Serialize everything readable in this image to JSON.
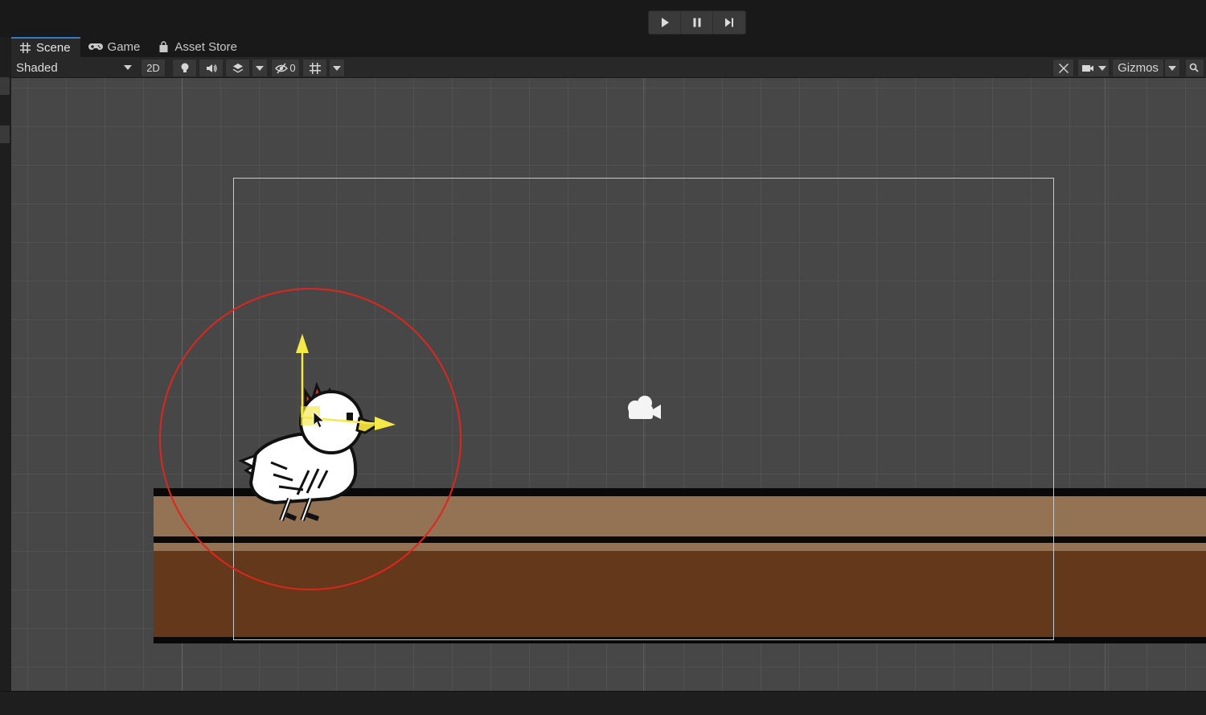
{
  "toolbar": {
    "play": "play-icon",
    "pause": "pause-icon",
    "step": "step-icon"
  },
  "tabs": [
    {
      "label": "Scene",
      "icon": "grid-hash-icon"
    },
    {
      "label": "Game",
      "icon": "gamepad-icon"
    },
    {
      "label": "Asset Store",
      "icon": "shopping-bag-icon"
    }
  ],
  "scene_toolbar": {
    "shading_mode": "Shaded",
    "mode_2d": "2D",
    "hidden_count": "0",
    "gizmos_label": "Gizmos"
  },
  "colors": {
    "accent_tab": "#3a79bb",
    "viewport_bg": "#474747",
    "ground_light": "#937353",
    "ground_dark": "#63381b",
    "highlight_circle": "#e0251d",
    "gizmo_yellow": "#f5e94a"
  }
}
